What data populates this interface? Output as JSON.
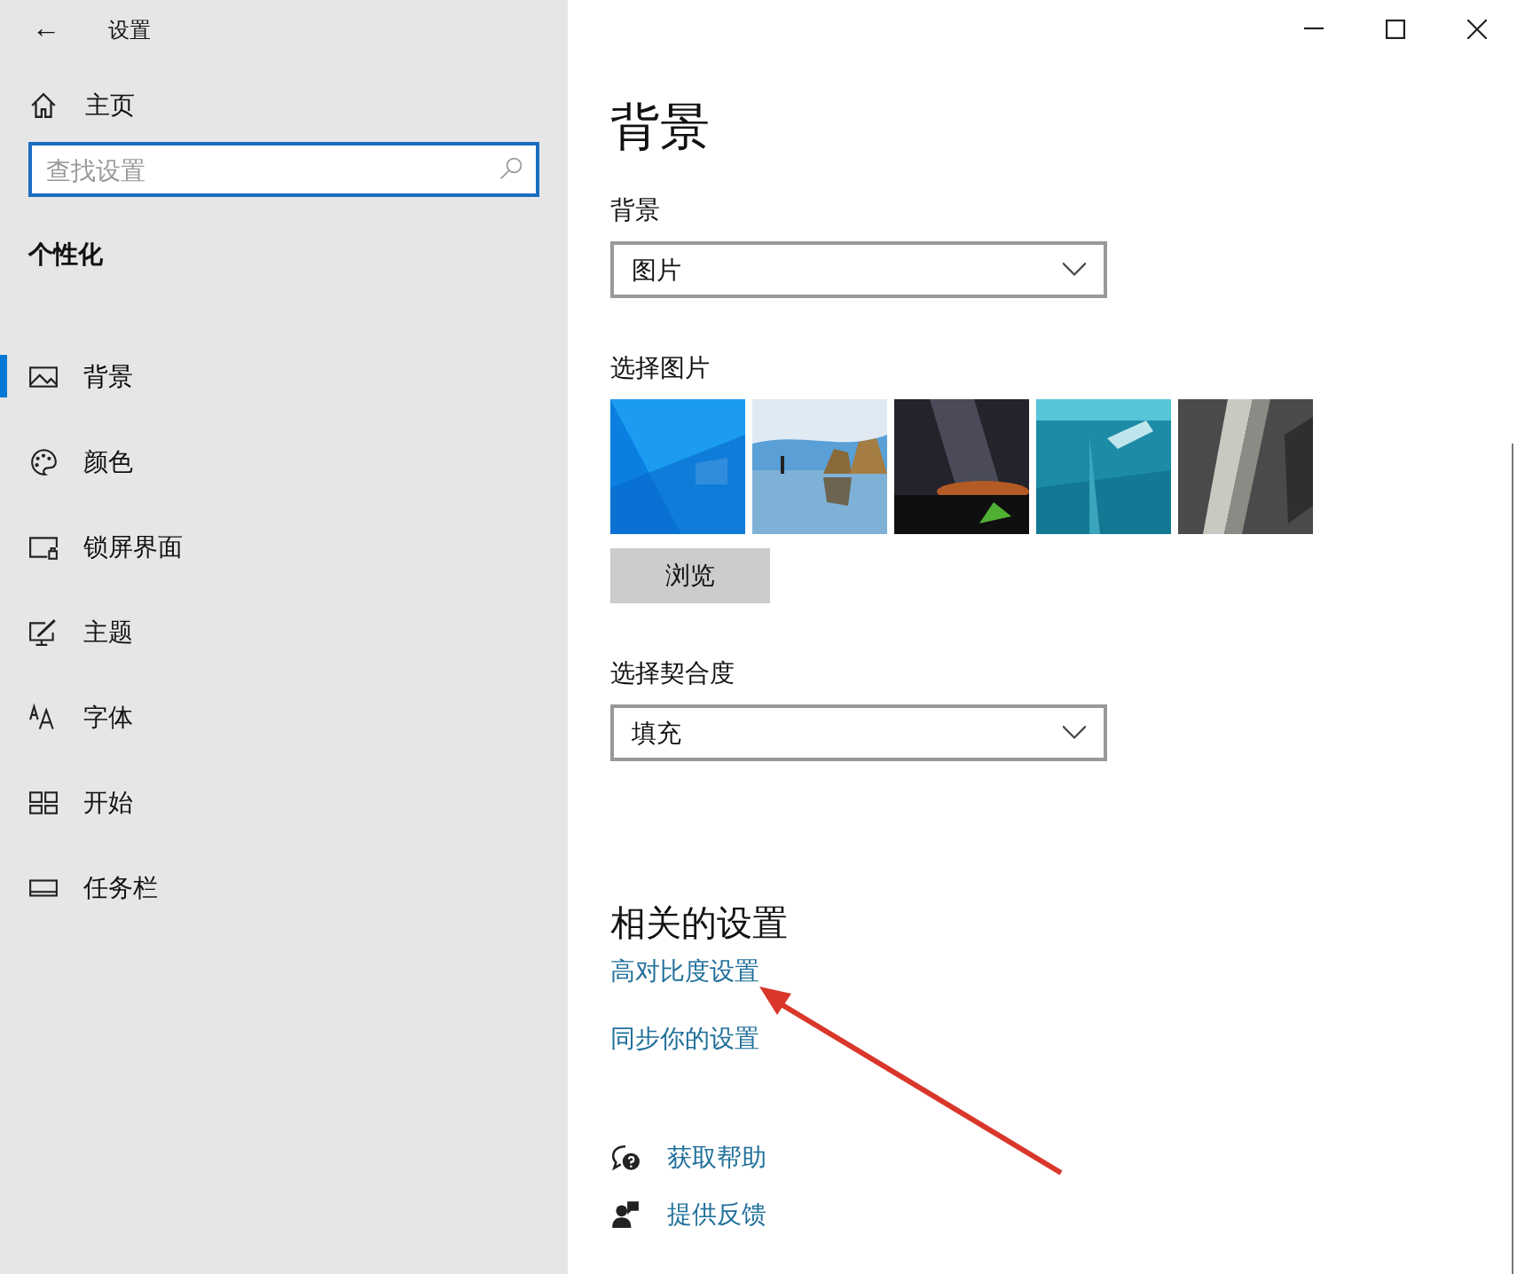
{
  "window": {
    "title": "设置",
    "back": "←"
  },
  "sidebar": {
    "home": "主页",
    "search": {
      "placeholder": "查找设置"
    },
    "section": "个性化",
    "items": [
      {
        "label": "背景",
        "selected": true
      },
      {
        "label": "颜色",
        "selected": false
      },
      {
        "label": "锁屏界面",
        "selected": false
      },
      {
        "label": "主题",
        "selected": false
      },
      {
        "label": "字体",
        "selected": false
      },
      {
        "label": "开始",
        "selected": false
      },
      {
        "label": "任务栏",
        "selected": false
      }
    ]
  },
  "page": {
    "title": "背景",
    "background": {
      "label": "背景",
      "value": "图片"
    },
    "choose_picture": {
      "label": "选择图片",
      "browse": "浏览"
    },
    "fit": {
      "label": "选择契合度",
      "value": "填充"
    },
    "related": {
      "title": "相关的设置",
      "links": [
        "高对比度设置",
        "同步你的设置"
      ]
    },
    "help": [
      {
        "label": "获取帮助"
      },
      {
        "label": "提供反馈"
      }
    ]
  }
}
